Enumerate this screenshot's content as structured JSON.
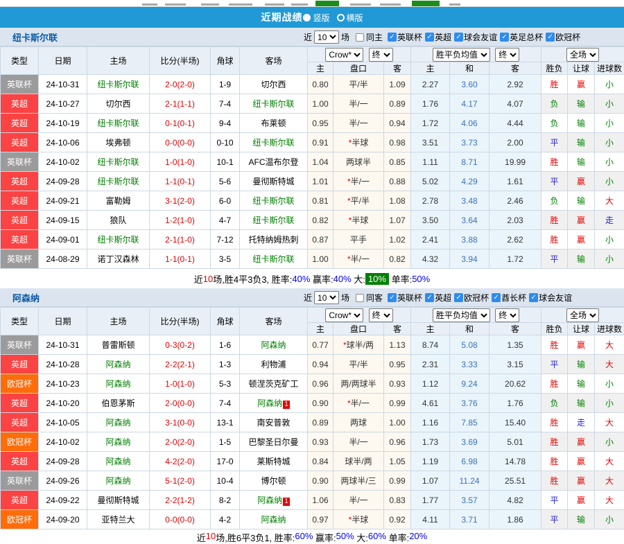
{
  "page": {
    "title": "近期战绩",
    "radio_vertical": "竖版",
    "radio_horizontal": "横版"
  },
  "filter_labels": {
    "near": "近",
    "games": "场"
  },
  "headers": {
    "type": "类型",
    "date": "日期",
    "home": "主场",
    "score": "比分(半场)",
    "corner": "角球",
    "away": "客场",
    "ah_home": "主",
    "handicap": "盘口",
    "ah_away": "客",
    "eu_home": "主",
    "eu_draw": "和",
    "eu_away": "客",
    "wdl": "胜负",
    "ah_result": "让球",
    "goals": "进球数"
  },
  "colors": {
    "accent_bar": "#2199D6",
    "team_green": "#008000",
    "score_red": "#E60000",
    "badge": {
      "英联杯": "#9B9B9B",
      "英超": "#FB4343",
      "欧冠杯": "#FF6C0A"
    },
    "outcome": {
      "胜": "#E60000",
      "平": "#2222DD",
      "负": "#008000",
      "赢": "#E60000",
      "输": "#008000",
      "走": "#2222DD",
      "大": "#E60000",
      "小": "#008000"
    }
  },
  "sections": [
    {
      "team": "纽卡斯尔联",
      "filter": {
        "count": "10",
        "same": "同主",
        "leagues": [
          "英联杯",
          "英超",
          "球会友谊",
          "英足总杯",
          "欧冠杯"
        ]
      },
      "dropdowns": {
        "company": "Crow*",
        "company_final": "终",
        "avg": "胜平负均值",
        "avg_final": "终",
        "scope": "全场"
      },
      "rows": [
        {
          "type": "英联杯",
          "date": "24-10-31",
          "home": "纽卡斯尔联",
          "home_green": true,
          "score": "2-0",
          "half": "(2-0)",
          "corner": "1-9",
          "away": "切尔西",
          "away_green": false,
          "away_card": "",
          "ah_home": "0.80",
          "handicap": "平/半",
          "ah_away": "1.09",
          "eu_home": "2.27",
          "eu_draw": "3.60",
          "eu_away": "2.92",
          "wdl": "胜",
          "ah_result": "赢",
          "goals": "小"
        },
        {
          "type": "英超",
          "date": "24-10-27",
          "home": "切尔西",
          "home_green": false,
          "score": "2-1",
          "half": "(1-1)",
          "corner": "7-4",
          "away": "纽卡斯尔联",
          "away_green": true,
          "away_card": "",
          "ah_home": "1.00",
          "handicap": "半/一",
          "ah_away": "0.89",
          "eu_home": "1.76",
          "eu_draw": "4.17",
          "eu_away": "4.07",
          "wdl": "负",
          "ah_result": "输",
          "goals": "小"
        },
        {
          "type": "英超",
          "date": "24-10-19",
          "home": "纽卡斯尔联",
          "home_green": true,
          "score": "0-1",
          "half": "(0-1)",
          "corner": "9-4",
          "away": "布莱顿",
          "away_green": false,
          "away_card": "",
          "ah_home": "0.95",
          "handicap": "半/一",
          "ah_away": "0.94",
          "eu_home": "1.72",
          "eu_draw": "4.06",
          "eu_away": "4.44",
          "wdl": "负",
          "ah_result": "输",
          "goals": "小"
        },
        {
          "type": "英超",
          "date": "24-10-06",
          "home": "埃弗顿",
          "home_green": false,
          "score": "0-0",
          "half": "(0-0)",
          "corner": "0-10",
          "away": "纽卡斯尔联",
          "away_green": true,
          "away_card": "",
          "ah_home": "0.91",
          "handicap": "*半球",
          "ah_away": "0.98",
          "eu_home": "3.51",
          "eu_draw": "3.73",
          "eu_away": "2.00",
          "wdl": "平",
          "ah_result": "输",
          "goals": "小"
        },
        {
          "type": "英联杯",
          "date": "24-10-02",
          "home": "纽卡斯尔联",
          "home_green": true,
          "score": "1-0",
          "half": "(1-0)",
          "corner": "10-1",
          "away": "AFC温布尔登",
          "away_green": false,
          "away_card": "",
          "ah_home": "1.04",
          "handicap": "两球半",
          "ah_away": "0.85",
          "eu_home": "1.11",
          "eu_draw": "8.71",
          "eu_away": "19.99",
          "wdl": "胜",
          "ah_result": "输",
          "goals": "小"
        },
        {
          "type": "英超",
          "date": "24-09-28",
          "home": "纽卡斯尔联",
          "home_green": true,
          "score": "1-1",
          "half": "(0-1)",
          "corner": "5-6",
          "away": "曼彻斯特城",
          "away_green": false,
          "away_card": "",
          "ah_home": "1.01",
          "handicap": "*半/一",
          "ah_away": "0.88",
          "eu_home": "5.02",
          "eu_draw": "4.29",
          "eu_away": "1.61",
          "wdl": "平",
          "ah_result": "赢",
          "goals": "小"
        },
        {
          "type": "英超",
          "date": "24-09-21",
          "home": "富勒姆",
          "home_green": false,
          "score": "3-1",
          "half": "(2-0)",
          "corner": "6-0",
          "away": "纽卡斯尔联",
          "away_green": true,
          "away_card": "",
          "ah_home": "0.81",
          "handicap": "*平/半",
          "ah_away": "1.08",
          "eu_home": "2.78",
          "eu_draw": "3.48",
          "eu_away": "2.46",
          "wdl": "负",
          "ah_result": "输",
          "goals": "大"
        },
        {
          "type": "英超",
          "date": "24-09-15",
          "home": "狼队",
          "home_green": false,
          "score": "1-2",
          "half": "(1-0)",
          "corner": "4-7",
          "away": "纽卡斯尔联",
          "away_green": true,
          "away_card": "",
          "ah_home": "0.82",
          "handicap": "*半球",
          "ah_away": "1.07",
          "eu_home": "3.50",
          "eu_draw": "3.64",
          "eu_away": "2.03",
          "wdl": "胜",
          "ah_result": "赢",
          "goals": "走"
        },
        {
          "type": "英超",
          "date": "24-09-01",
          "home": "纽卡斯尔联",
          "home_green": true,
          "score": "2-1",
          "half": "(1-0)",
          "corner": "7-12",
          "away": "托特纳姆热刺",
          "away_green": false,
          "away_card": "",
          "ah_home": "0.87",
          "handicap": "平手",
          "ah_away": "1.02",
          "eu_home": "2.41",
          "eu_draw": "3.88",
          "eu_away": "2.62",
          "wdl": "胜",
          "ah_result": "赢",
          "goals": "小"
        },
        {
          "type": "英联杯",
          "date": "24-08-29",
          "home": "诺丁汉森林",
          "home_green": false,
          "score": "1-1",
          "half": "(0-1)",
          "corner": "3-5",
          "away": "纽卡斯尔联",
          "away_green": true,
          "away_card": "",
          "ah_home": "1.00",
          "handicap": "*半/一",
          "ah_away": "0.82",
          "eu_home": "4.32",
          "eu_draw": "3.94",
          "eu_away": "1.72",
          "wdl": "平",
          "ah_result": "输",
          "goals": "小"
        }
      ],
      "summary": {
        "parts": [
          {
            "text": "近",
            "color": "#000000"
          },
          {
            "text": "10",
            "color": "#E60000"
          },
          {
            "text": "场,胜4平3负3, 胜率:",
            "color": "#000000"
          },
          {
            "text": "40%",
            "color": "#0000EE"
          },
          {
            "text": " 赢率:",
            "color": "#000000"
          },
          {
            "text": "40%",
            "color": "#0000EE"
          },
          {
            "text": " 大:",
            "color": "#000000"
          },
          {
            "text": "10%",
            "color": "#FFFFFF",
            "bg": "#008000"
          },
          {
            "text": " 单率:",
            "color": "#000000"
          },
          {
            "text": "50%",
            "color": "#0000EE"
          }
        ]
      }
    },
    {
      "team": "阿森纳",
      "filter": {
        "count": "10",
        "same": "同客",
        "leagues": [
          "英联杯",
          "英超",
          "欧冠杯",
          "酋长杯",
          "球会友谊"
        ]
      },
      "dropdowns": {
        "company": "Crow*",
        "company_final": "终",
        "avg": "胜平负均值",
        "avg_final": "终",
        "scope": "全场"
      },
      "rows": [
        {
          "type": "英联杯",
          "date": "24-10-31",
          "home": "普雷斯顿",
          "home_green": false,
          "score": "0-3",
          "half": "(0-2)",
          "corner": "1-6",
          "away": "阿森纳",
          "away_green": true,
          "away_card": "",
          "ah_home": "0.77",
          "handicap": "*球半/两",
          "ah_away": "1.13",
          "eu_home": "8.74",
          "eu_draw": "5.08",
          "eu_away": "1.35",
          "wdl": "胜",
          "ah_result": "赢",
          "goals": "大"
        },
        {
          "type": "英超",
          "date": "24-10-28",
          "home": "阿森纳",
          "home_green": true,
          "score": "2-2",
          "half": "(2-1)",
          "corner": "1-3",
          "away": "利物浦",
          "away_green": false,
          "away_card": "",
          "ah_home": "0.94",
          "handicap": "平/半",
          "ah_away": "0.95",
          "eu_home": "2.31",
          "eu_draw": "3.33",
          "eu_away": "3.15",
          "wdl": "平",
          "ah_result": "输",
          "goals": "大"
        },
        {
          "type": "欧冠杯",
          "date": "24-10-23",
          "home": "阿森纳",
          "home_green": true,
          "score": "1-0",
          "half": "(1-0)",
          "corner": "5-3",
          "away": "顿涅茨克矿工",
          "away_green": false,
          "away_card": "",
          "ah_home": "0.96",
          "handicap": "两/两球半",
          "ah_away": "0.93",
          "eu_home": "1.12",
          "eu_draw": "9.24",
          "eu_away": "20.62",
          "wdl": "胜",
          "ah_result": "输",
          "goals": "小"
        },
        {
          "type": "英超",
          "date": "24-10-20",
          "home": "伯恩茅斯",
          "home_green": false,
          "score": "2-0",
          "half": "(0-0)",
          "corner": "7-4",
          "away": "阿森纳",
          "away_green": true,
          "away_card": "1",
          "ah_home": "0.90",
          "handicap": "*半/一",
          "ah_away": "0.99",
          "eu_home": "4.61",
          "eu_draw": "3.76",
          "eu_away": "1.76",
          "wdl": "负",
          "ah_result": "输",
          "goals": "小"
        },
        {
          "type": "英超",
          "date": "24-10-05",
          "home": "阿森纳",
          "home_green": true,
          "score": "3-1",
          "half": "(0-0)",
          "corner": "13-1",
          "away": "南安普敦",
          "away_green": false,
          "away_card": "",
          "ah_home": "0.89",
          "handicap": "两球",
          "ah_away": "1.00",
          "eu_home": "1.16",
          "eu_draw": "7.85",
          "eu_away": "15.40",
          "wdl": "胜",
          "ah_result": "走",
          "goals": "大"
        },
        {
          "type": "欧冠杯",
          "date": "24-10-02",
          "home": "阿森纳",
          "home_green": true,
          "score": "2-0",
          "half": "(2-0)",
          "corner": "1-5",
          "away": "巴黎圣日尔曼",
          "away_green": false,
          "away_card": "",
          "ah_home": "0.93",
          "handicap": "半/一",
          "ah_away": "0.96",
          "eu_home": "1.73",
          "eu_draw": "3.69",
          "eu_away": "5.01",
          "wdl": "胜",
          "ah_result": "赢",
          "goals": "小"
        },
        {
          "type": "英超",
          "date": "24-09-28",
          "home": "阿森纳",
          "home_green": true,
          "score": "4-2",
          "half": "(2-0)",
          "corner": "17-0",
          "away": "莱斯特城",
          "away_green": false,
          "away_card": "",
          "ah_home": "0.84",
          "handicap": "球半/两",
          "ah_away": "1.05",
          "eu_home": "1.19",
          "eu_draw": "6.98",
          "eu_away": "14.78",
          "wdl": "胜",
          "ah_result": "赢",
          "goals": "大"
        },
        {
          "type": "英联杯",
          "date": "24-09-26",
          "home": "阿森纳",
          "home_green": true,
          "score": "5-1",
          "half": "(2-0)",
          "corner": "10-4",
          "away": "博尔顿",
          "away_green": false,
          "away_card": "",
          "ah_home": "0.90",
          "handicap": "两球半/三",
          "ah_away": "0.99",
          "eu_home": "1.07",
          "eu_draw": "11.24",
          "eu_away": "25.51",
          "wdl": "胜",
          "ah_result": "赢",
          "goals": "大"
        },
        {
          "type": "英超",
          "date": "24-09-22",
          "home": "曼彻斯特城",
          "home_green": false,
          "score": "2-2",
          "half": "(1-2)",
          "corner": "8-2",
          "away": "阿森纳",
          "away_green": true,
          "away_card": "1",
          "ah_home": "1.06",
          "handicap": "半/一",
          "ah_away": "0.83",
          "eu_home": "1.77",
          "eu_draw": "3.57",
          "eu_away": "4.82",
          "wdl": "平",
          "ah_result": "赢",
          "goals": "大"
        },
        {
          "type": "欧冠杯",
          "date": "24-09-20",
          "home": "亚特兰大",
          "home_green": false,
          "score": "0-0",
          "half": "(0-0)",
          "corner": "4-2",
          "away": "阿森纳",
          "away_green": true,
          "away_card": "",
          "ah_home": "0.97",
          "handicap": "*半球",
          "ah_away": "0.92",
          "eu_home": "4.11",
          "eu_draw": "3.71",
          "eu_away": "1.86",
          "wdl": "平",
          "ah_result": "输",
          "goals": "小"
        }
      ],
      "summary": {
        "parts": [
          {
            "text": "近",
            "color": "#000000"
          },
          {
            "text": "10",
            "color": "#E60000"
          },
          {
            "text": "场,胜6平3负1, 胜率:",
            "color": "#000000"
          },
          {
            "text": "60%",
            "color": "#0000EE"
          },
          {
            "text": " 赢率:",
            "color": "#000000"
          },
          {
            "text": "50%",
            "color": "#0000EE"
          },
          {
            "text": " 大:",
            "color": "#000000"
          },
          {
            "text": "60%",
            "color": "#0000EE"
          },
          {
            "text": " 单率:",
            "color": "#000000"
          },
          {
            "text": "20%",
            "color": "#0000EE"
          }
        ]
      }
    }
  ]
}
